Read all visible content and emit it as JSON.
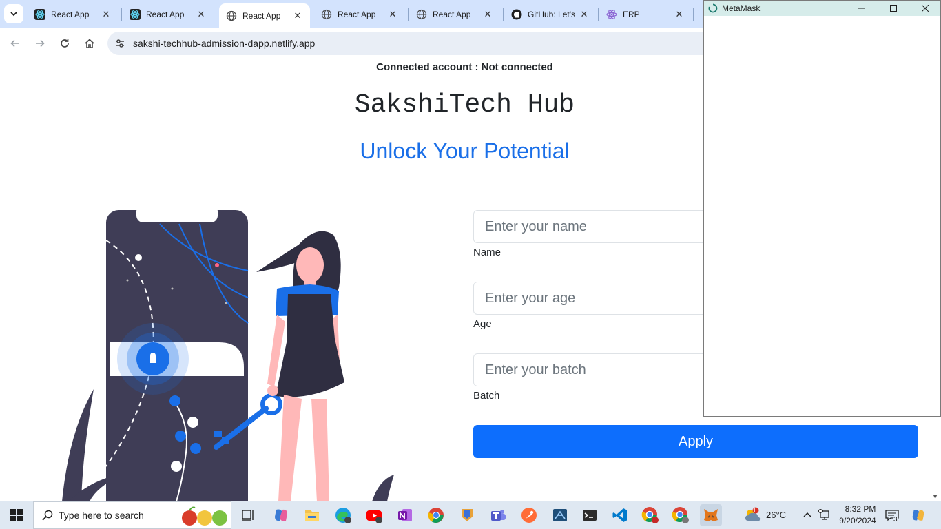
{
  "browser": {
    "tabs": [
      {
        "title": "React App",
        "favicon": "react-icon",
        "active": false
      },
      {
        "title": "React App",
        "favicon": "react-icon",
        "active": false
      },
      {
        "title": "React App",
        "favicon": "globe-icon",
        "active": true
      },
      {
        "title": "React App",
        "favicon": "globe-icon",
        "active": false
      },
      {
        "title": "React App",
        "favicon": "globe-icon",
        "active": false
      },
      {
        "title": "GitHub: Let's",
        "favicon": "github-icon",
        "active": false
      },
      {
        "title": "ERP",
        "favicon": "react-icon",
        "active": false
      }
    ],
    "url": "sakshi-techhub-admission-dapp.netlify.app"
  },
  "page": {
    "connected_account": "Connected account : Not connected",
    "brand": "SakshiTech Hub",
    "tagline": "Unlock Your Potential",
    "form": {
      "name": {
        "placeholder": "Enter your name",
        "label": "Name"
      },
      "age": {
        "placeholder": "Enter your age",
        "label": "Age"
      },
      "batch": {
        "placeholder": "Enter your batch",
        "label": "Batch"
      },
      "apply_label": "Apply"
    },
    "colors": {
      "accent": "#0d6efd",
      "tagline": "#1a6fe8",
      "phone": "#3f3d56"
    }
  },
  "metamask": {
    "title": "MetaMask"
  },
  "taskbar": {
    "search_placeholder": "Type here to search",
    "weather": "26°C",
    "time": "8:32 PM",
    "date": "9/20/2024",
    "notification_count": "3",
    "weather_badge": "1"
  }
}
